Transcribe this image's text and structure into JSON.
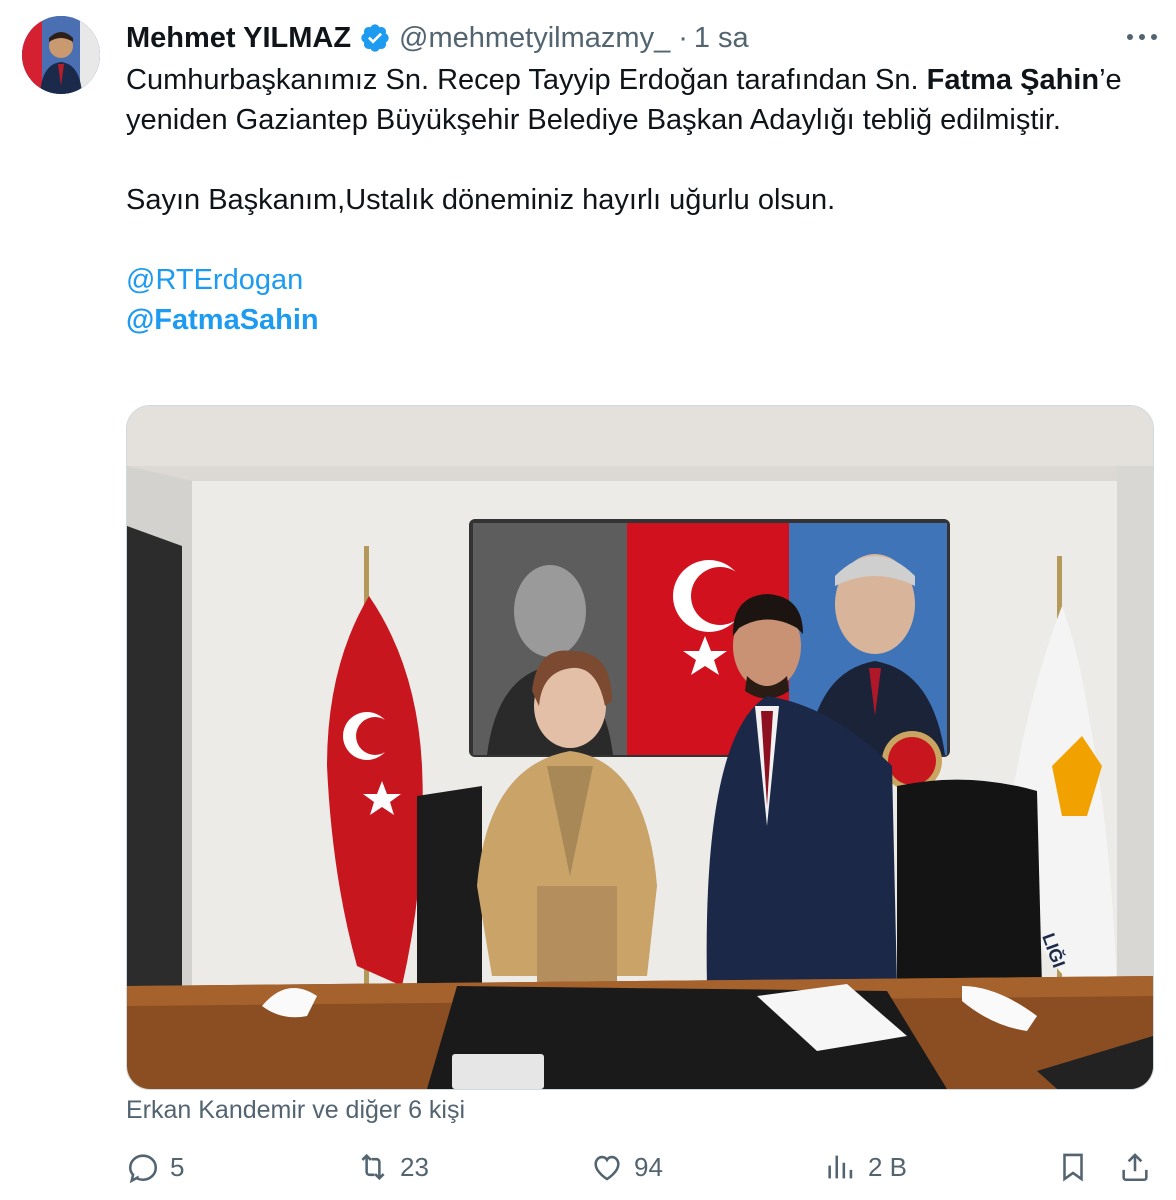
{
  "author": {
    "name": "Mehmet YILMAZ",
    "handle": "@mehmetyilmazmy_",
    "separator": "·",
    "time": "1 sa"
  },
  "tweet": {
    "text_part1": "Cumhurbaşkanımız Sn. Recep Tayyip Erdoğan tarafından Sn. ",
    "text_bold": "Fatma Şahin",
    "text_part2": "’e yeniden Gaziantep Büyükşehir Belediye Başkan Adaylığı tebliğ edilmiştir.",
    "text_line2": "Sayın Başkanım,Ustalık döneminiz hayırlı uğurlu olsun.",
    "mention1": "@RTErdogan",
    "mention2": "@FatmaSahin"
  },
  "photo": {
    "banner_text": "LIĞI"
  },
  "tagged": "Erkan Kandemir ve diğer 6 kişi",
  "actions": {
    "replies": "5",
    "retweets": "23",
    "likes": "94",
    "views": "2 B"
  },
  "icons": [
    "verified-badge-icon",
    "more-icon",
    "reply-icon",
    "retweet-icon",
    "like-icon",
    "views-icon",
    "bookmark-icon",
    "share-icon"
  ],
  "colors": {
    "link": "#1d9bf0",
    "secondary": "#536471",
    "verified": "#1d9bf0"
  }
}
